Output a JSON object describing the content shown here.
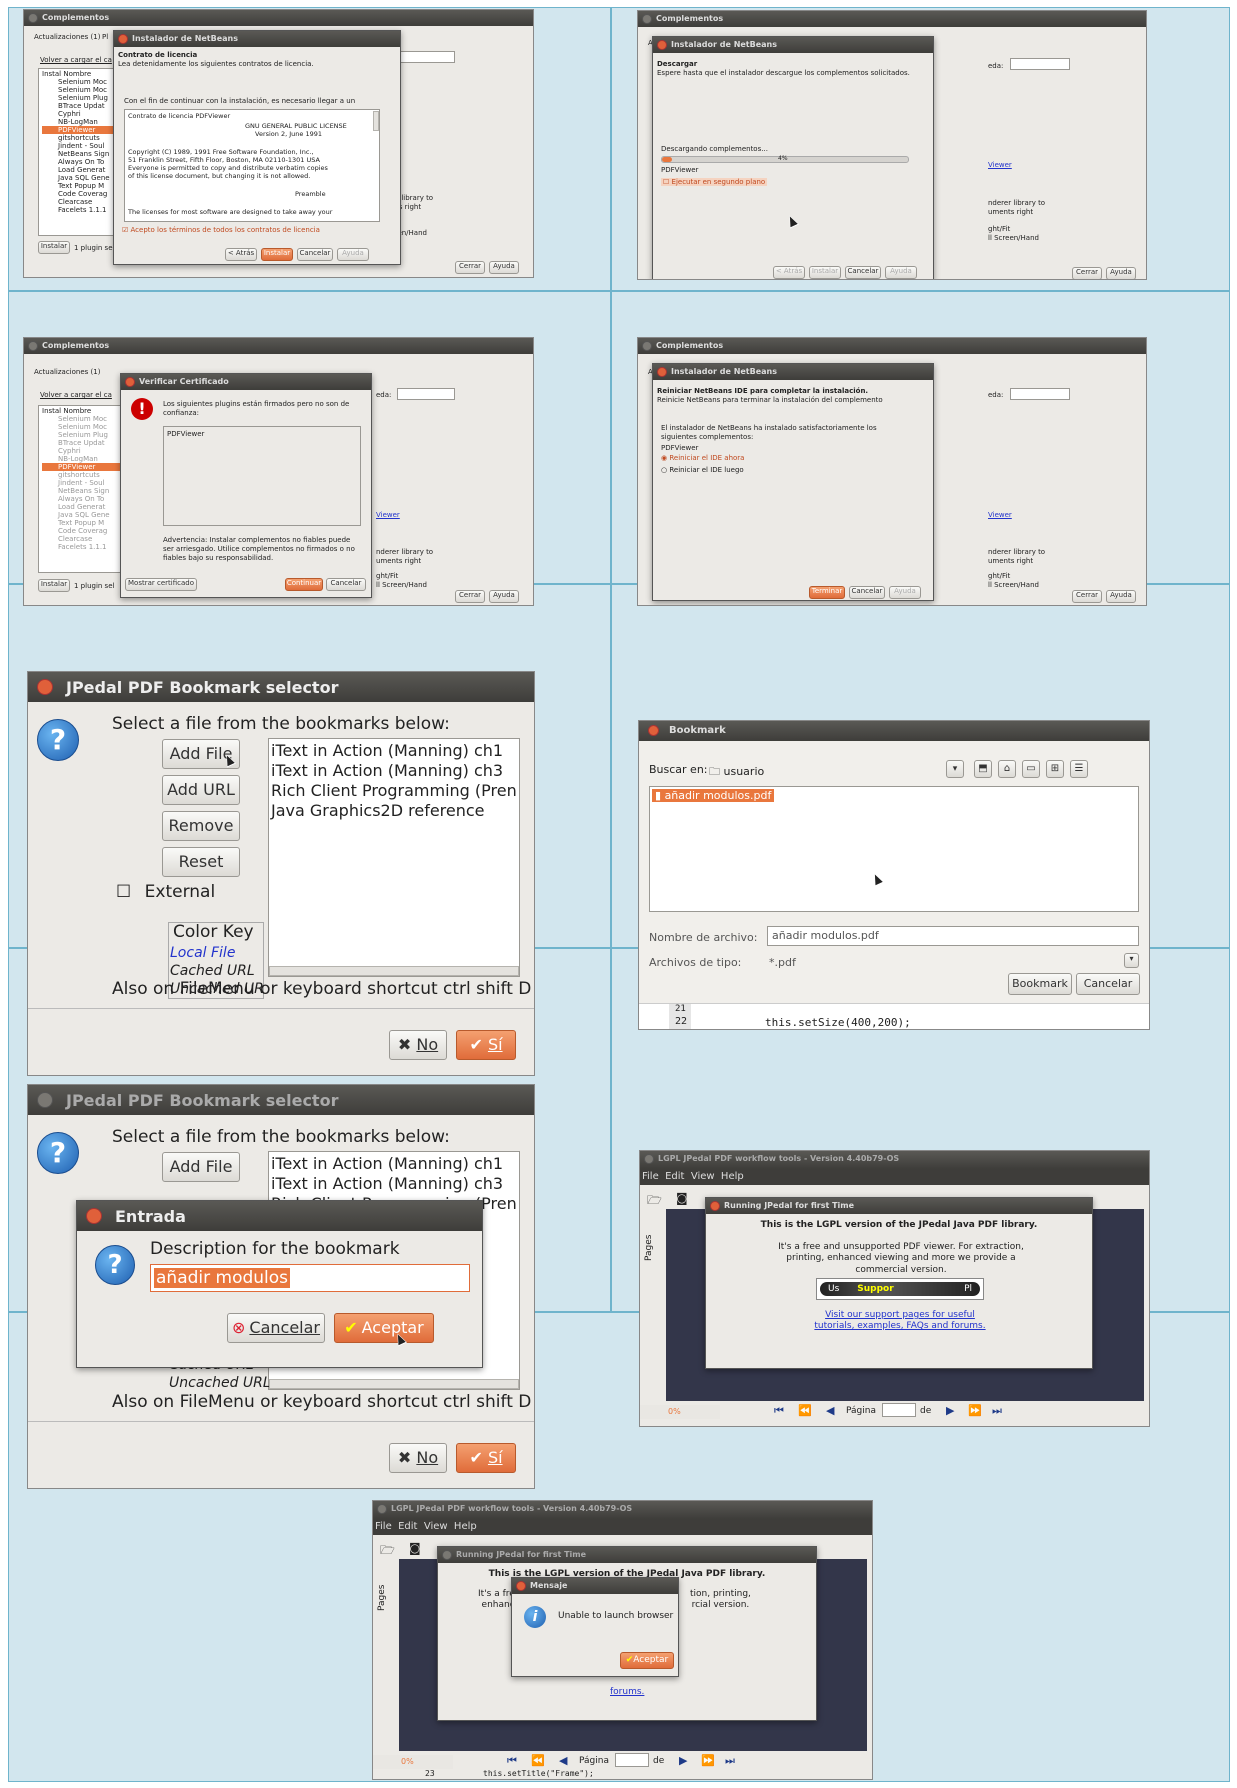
{
  "nb": {
    "title": "Complementos",
    "tab_updates": "Actualizaciones (1)",
    "tab_plugins": "Pl",
    "reload": "Volver a cargar el ca",
    "col_install": "Instal",
    "col_name": "Nombre",
    "search": "eda:",
    "plugins": [
      "Selenium Moc",
      "Selenium Moc",
      "Selenium Plug",
      "BTrace Updat",
      "Cyphri",
      "NB-LogMan",
      "PDFViewer",
      "gitshortcuts",
      "Jindent - Soul",
      "NetBeans Sign",
      "Always On To",
      "Load Generat",
      "Java SQL Gene",
      "Text Popup M",
      "Code Coverag",
      "Clearcase",
      "Facelets 1.1.1"
    ],
    "right_texts": [
      "Viewer",
      "nderer library to",
      "uments right",
      "ght/Fit",
      "ll Screen/Hand"
    ],
    "install": "Instalar",
    "selected": "1 plugin sel",
    "close": "Cerrar",
    "help": "Ayuda"
  },
  "s1": {
    "title": "Instalador de NetBeans",
    "heading": "Contrato de licencia",
    "sub": "Lea detenidamente los siguientes contratos de licencia.",
    "intro": "Con el fin de continuar con la instalación, es necesario llegar a un",
    "lic_name": "Contrato de licencia PDFViewer",
    "lic1": "GNU GENERAL PUBLIC LICENSE",
    "lic2": "Version 2, June 1991",
    "lic3": "Copyright (C) 1989, 1991 Free Software Foundation, Inc.,\n51 Franklin Street, Fifth Floor, Boston, MA 02110-1301 USA\nEveryone is permitted to copy and distribute verbatim copies\nof this license document, but changing it is not allowed.",
    "lic4": "Preamble",
    "lic5": "The licenses for most software are designed to take away your",
    "accept": "Acepto los términos de todos los contratos de licencia",
    "back": "< Atrás",
    "install": "Instalar",
    "cancel": "Cancelar",
    "help": "Ayuda"
  },
  "s2": {
    "title": "Instalador de NetBeans",
    "heading": "Descargar",
    "sub": "Espere hasta que el instalador descargue los complementos solicitados.",
    "downloading": "Descargando complementos...",
    "pct": "4%",
    "progress": 0.04,
    "item": "PDFViewer",
    "background": "Ejecutar en segundo plano",
    "back": "< Atrás",
    "install": "Instalar",
    "cancel": "Cancelar",
    "help": "Ayuda"
  },
  "s3": {
    "title": "Verificar Certificado",
    "msg": "Los siguientes plugins están firmados pero no son de confianza:",
    "item": "PDFViewer",
    "warn": "Advertencia: Instalar complementos no fiables puede ser arriesgado. Utilice complementos no firmados o no fiables bajo su responsabilidad.",
    "show": "Mostrar certificado",
    "continue": "Continuar",
    "cancel": "Cancelar"
  },
  "s4": {
    "title": "Instalador de NetBeans",
    "heading": "Reiniciar NetBeans IDE para completar la instalación.",
    "sub": "Reinicie NetBeans para terminar la instalación del complemento",
    "msg": "El instalador de NetBeans ha instalado satisfactoriamente los siguientes complementos:",
    "item": "PDFViewer",
    "now": "Reiniciar el IDE ahora",
    "later": "Reiniciar el IDE luego",
    "finish": "Terminar",
    "cancel": "Cancelar",
    "help": "Ayuda"
  },
  "s5": {
    "title": "JPedal PDF Bookmark selector",
    "prompt": "Select a file from the bookmarks below:",
    "add_file": "Add File",
    "add_url": "Add URL",
    "remove": "Remove",
    "reset": "Reset",
    "external": "External",
    "color_key": "Color Key",
    "local": "Local File",
    "cached": "Cached URL",
    "uncached": "Uncached URL",
    "bookmarks": [
      "iText in Action (Manning) ch1",
      "iText in Action (Manning) ch3",
      "Rich Client Programming (Pren",
      "Java Graphics2D reference"
    ],
    "also": "Also on FileMenu or keyboard shortcut ctrl shift D",
    "no": "No",
    "yes": "Sí"
  },
  "s6": {
    "title": "Bookmark",
    "lookin": "Buscar en:",
    "folder": "usuario",
    "file": "añadir modulos.pdf",
    "filename_label": "Nombre de archivo:",
    "filename": "añadir modulos.pdf",
    "type_label": "Archivos de tipo:",
    "type": "*.pdf",
    "bookmark": "Bookmark",
    "cancel": "Cancelar",
    "line21": "21",
    "line22": "22",
    "code": "this.setSize(400,200);"
  },
  "s7": {
    "title": "Entrada",
    "label": "Description for the bookmark",
    "value": "añadir modulos",
    "cancel": "Cancelar",
    "accept": "Aceptar"
  },
  "jp": {
    "title": "LGPL JPedal PDF workflow tools - Version 4.40b79-OS",
    "menu": [
      "File",
      "Edit",
      "View",
      "Help"
    ],
    "pages": "Pages",
    "dlg_title": "Running JPedal for first Time",
    "headline": "This is the LGPL version of the JPedal Java PDF library.",
    "body": "It's a free and unsupported PDF viewer. For extraction, printing, enhanced viewing and more we provide a commercial version.",
    "banner_l": "Us",
    "banner_m": "Suppor",
    "banner_r": "Pl",
    "link": "Visit our support pages for useful tutorials, examples, FAQs and forums.",
    "pct": "0%",
    "page": "Página",
    "of": "de"
  },
  "s9": {
    "body_l": "It's a free and\nenhanced vi",
    "body_r": "tion, printing,\nrcial version.",
    "link_tail": "forums.",
    "msg_title": "Mensaje",
    "msg": "Unable to launch browser",
    "accept": "Aceptar",
    "line": "23",
    "code": "this.setTitle(\"Frame\");"
  }
}
